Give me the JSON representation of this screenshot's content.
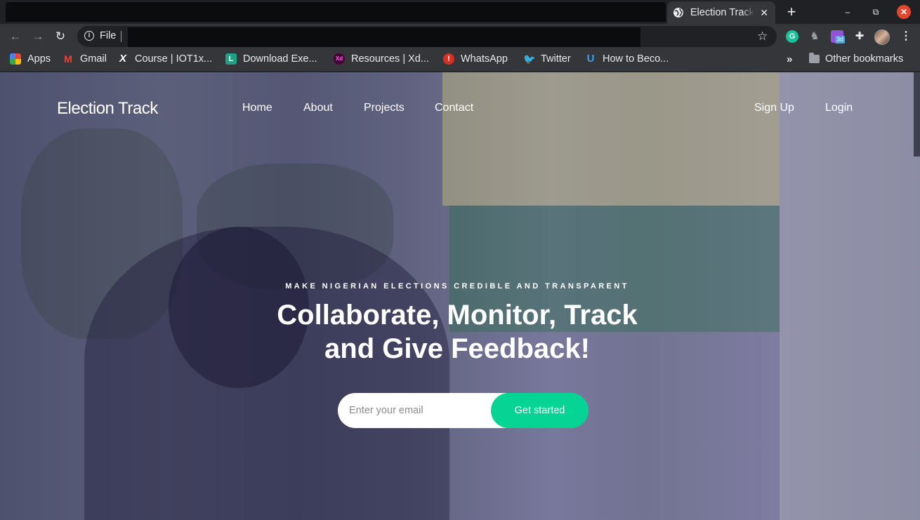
{
  "browser": {
    "tab": {
      "title": "Election Track",
      "close_glyph": "✕"
    },
    "new_tab_glyph": "+",
    "window": {
      "minimize": "–",
      "maximize": "⧉",
      "close": "✕"
    },
    "omnibox": {
      "scheme_label": "File",
      "star_glyph": "☆"
    },
    "nav": {
      "back": "←",
      "forward": "→",
      "reload": "↻"
    },
    "extensions": {
      "grammarly": "G",
      "calendar_badge": "3d",
      "puzzle": "✚",
      "menu": "⋮",
      "ghost": "♞"
    },
    "bookmarks": [
      {
        "label": "Apps",
        "icon": "apps-grid-icon",
        "glyph": ""
      },
      {
        "label": "Gmail",
        "icon": "gmail-icon",
        "glyph": "M"
      },
      {
        "label": "Course | IOT1x...",
        "icon": "edx-icon",
        "glyph": "X"
      },
      {
        "label": "Download Exe...",
        "icon": "download-site-icon",
        "glyph": "L"
      },
      {
        "label": "Resources | Xd...",
        "icon": "xd-icon",
        "glyph": "Xd"
      },
      {
        "label": "WhatsApp",
        "icon": "whatsapp-alert-icon",
        "glyph": "!"
      },
      {
        "label": "Twitter",
        "icon": "twitter-icon",
        "glyph": "🐦"
      },
      {
        "label": "How to Beco...",
        "icon": "udacity-icon",
        "glyph": "U"
      }
    ],
    "bookmarks_overflow": "»",
    "other_bookmarks": "Other bookmarks"
  },
  "site": {
    "logo": "Election Track",
    "nav": {
      "home": "Home",
      "about": "About",
      "projects": "Projects",
      "contact": "Contact",
      "signup": "Sign Up",
      "login": "Login"
    },
    "hero": {
      "tagline": "MAKE NIGERIAN ELECTIONS CREDIBLE AND TRANSPARENT",
      "headline_line1": "Collaborate, Monitor, Track",
      "headline_line2": "and Give Feedback!",
      "email_placeholder": "Enter your email",
      "cta_label": "Get started"
    },
    "colors": {
      "overlay": "#474284",
      "cta": "#05d494"
    }
  }
}
